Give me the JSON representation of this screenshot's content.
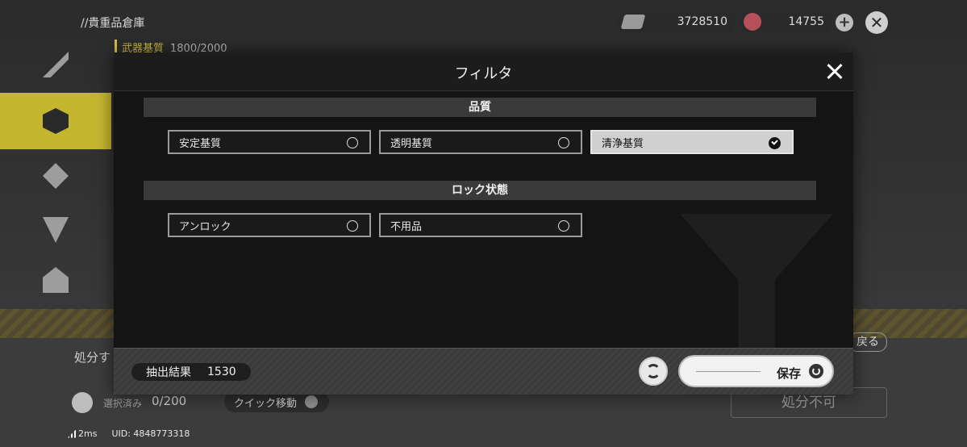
{
  "header": {
    "breadcrumb": "//貴重品倉庫",
    "category_label": "武器基質",
    "category_count": "1800/2000",
    "currency1_value": "3728510",
    "currency2_value": "14755",
    "plus_glyph": "+",
    "close_glyph": "✕"
  },
  "sidebar": {
    "items": [
      {
        "name": "sidebar-item-1"
      },
      {
        "name": "sidebar-item-2-active"
      }
    ]
  },
  "background": {
    "dispose_label": "処分す",
    "back_label": "戻る",
    "disable_label": "処分不可",
    "selected_label": "選択済み",
    "selected_count": "0/200",
    "quick_move_label": "クイック移動",
    "ping": "2ms",
    "uid": "UID: 4848773318"
  },
  "modal": {
    "title": "フィルタ",
    "sections": [
      {
        "heading": "品質",
        "options": [
          {
            "label": "安定基質",
            "selected": false
          },
          {
            "label": "透明基質",
            "selected": false
          },
          {
            "label": "清浄基質",
            "selected": true
          }
        ]
      },
      {
        "heading": "ロック状態",
        "options": [
          {
            "label": "アンロック",
            "selected": false
          },
          {
            "label": "不用品",
            "selected": false
          }
        ]
      }
    ],
    "footer": {
      "result_label": "抽出結果",
      "result_count": "1530",
      "save_label": "保存"
    }
  }
}
